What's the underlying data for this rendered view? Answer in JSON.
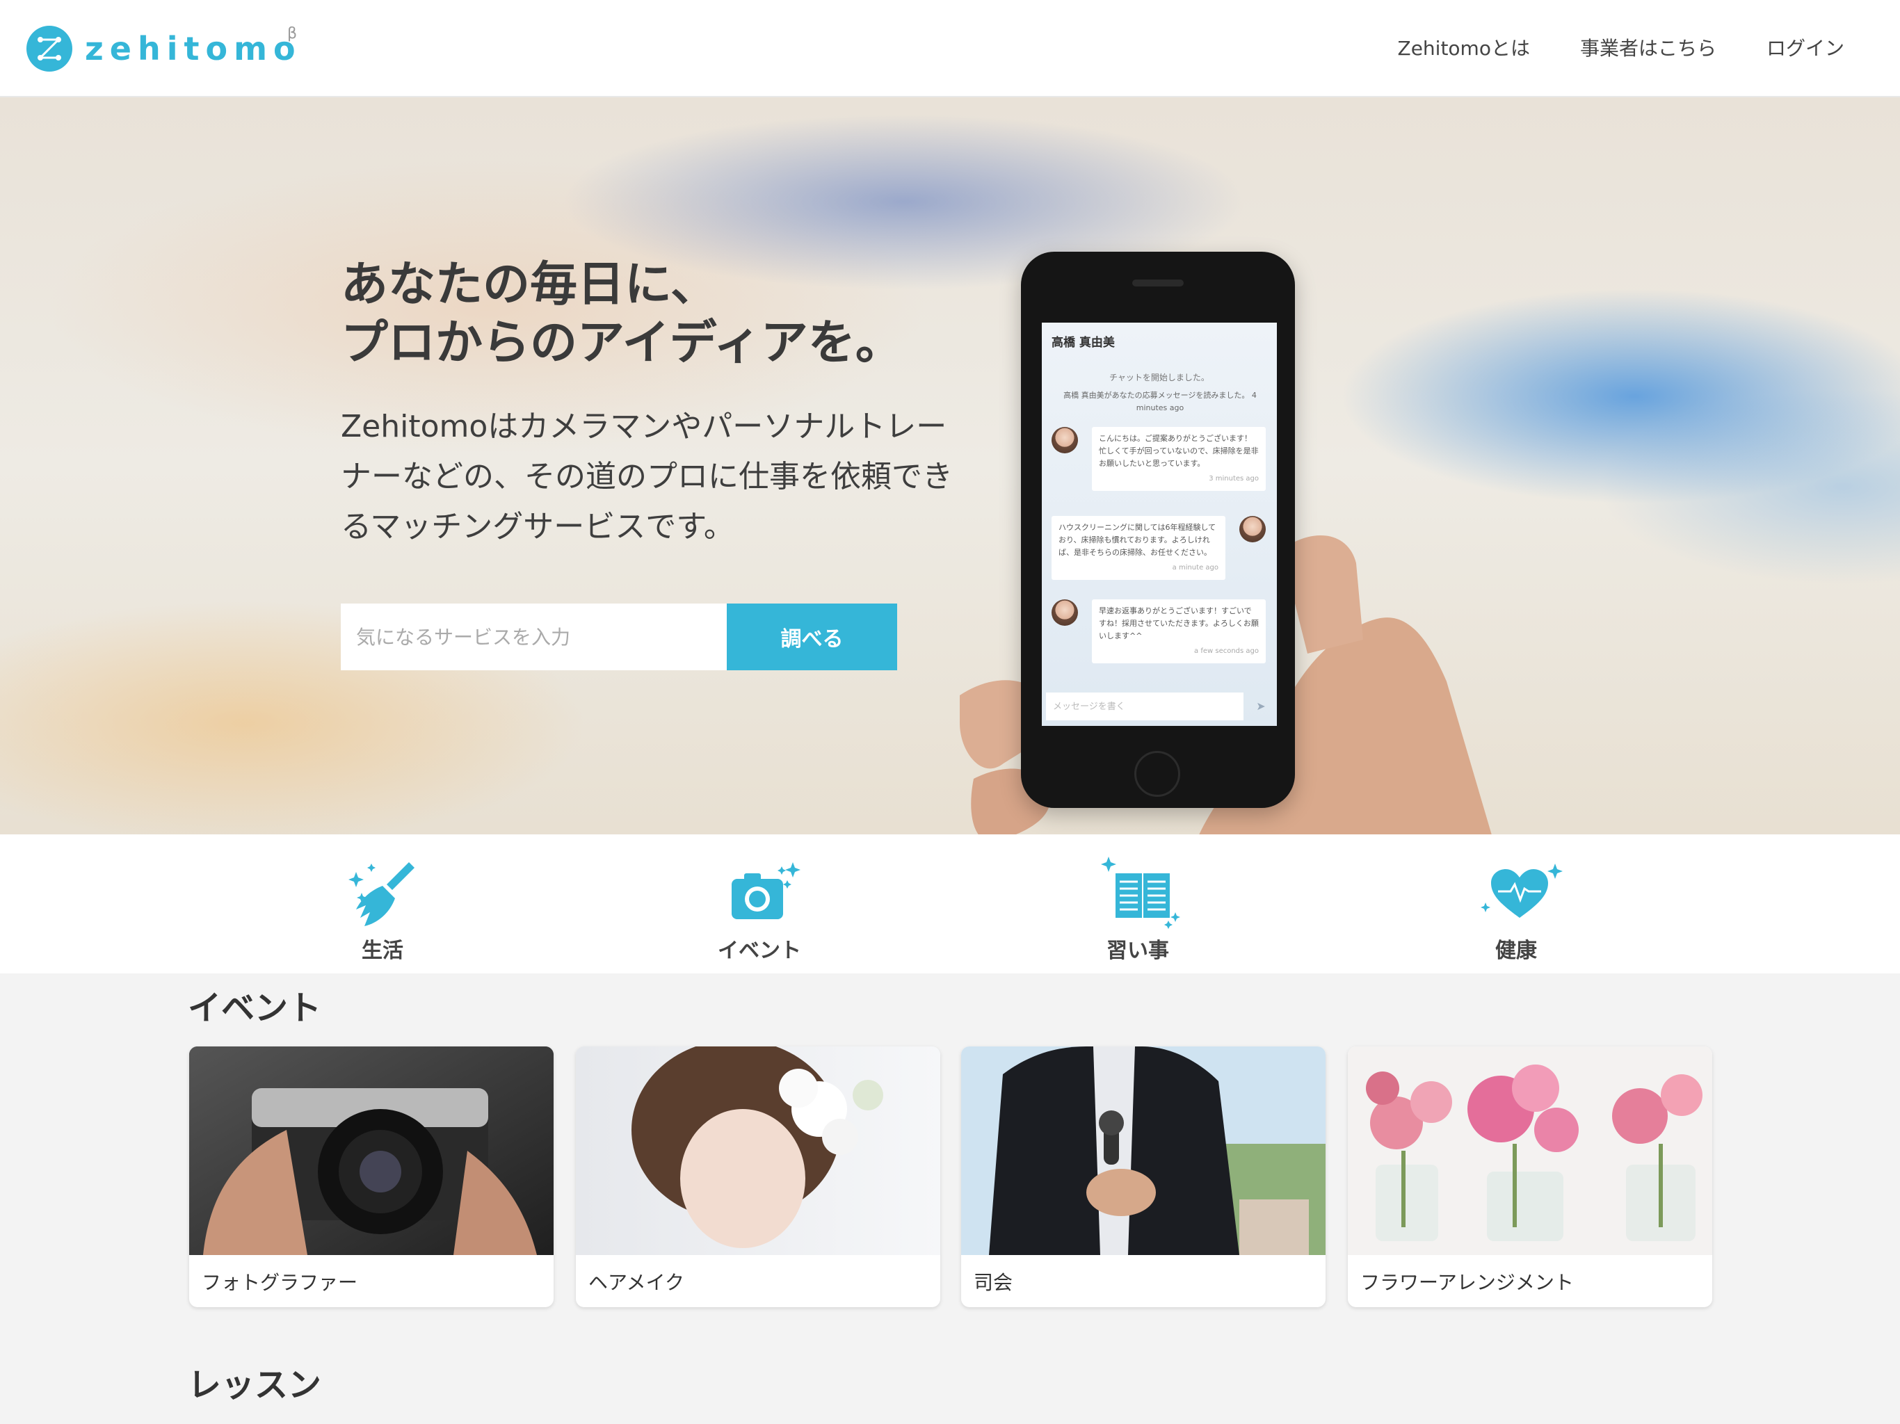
{
  "header": {
    "logo_text": "zehitomo",
    "logo_beta": "β",
    "nav": [
      "Zehitomoとは",
      "事業者はこちら",
      "ログイン"
    ]
  },
  "hero": {
    "title": "あなたの毎日に、\nプロからのアイディアを。",
    "subtitle": "Zehitomoはカメラマンやパーソナルトレーナーなどの、その道のプロに仕事を依頼できるマッチングサービスです。",
    "search_placeholder": "気になるサービスを入力",
    "search_button": "調べる"
  },
  "phone_chat": {
    "name": "高橋 真由美",
    "system1": "チャットを開始しました。",
    "system2": "高橋 真由美があなたの応募メッセージを読みました。 4 minutes ago",
    "messages": [
      {
        "text": "こんにちは。ご提案ありがとうございます！忙しくて手が回っていないので、床掃除を是非お願いしたいと思っています。",
        "time": "3 minutes ago"
      },
      {
        "text": "ハウスクリーニングに関しては6年程経験しており、床掃除も慣れております。よろしければ、是非そちらの床掃除、お任せください。",
        "time": "a minute ago"
      },
      {
        "text": "早速お返事ありがとうございます！すごいですね！採用させていただきます。よろしくお願いします^^",
        "time": "a few seconds ago"
      }
    ],
    "input_placeholder": "メッセージを書く"
  },
  "categories": [
    {
      "label": "生活",
      "icon": "broom-icon"
    },
    {
      "label": "イベント",
      "icon": "camera-icon"
    },
    {
      "label": "習い事",
      "icon": "book-icon"
    },
    {
      "label": "健康",
      "icon": "heart-pulse-icon"
    }
  ],
  "events_section": {
    "title": "イベント",
    "cards": [
      "フォトグラファー",
      "ヘアメイク",
      "司会",
      "フラワーアレンジメント"
    ]
  },
  "lessons_section": {
    "title": "レッスン"
  },
  "colors": {
    "accent": "#35b6d8",
    "header_bg": "#ffffff",
    "page_bg": "#f3f3f3"
  }
}
